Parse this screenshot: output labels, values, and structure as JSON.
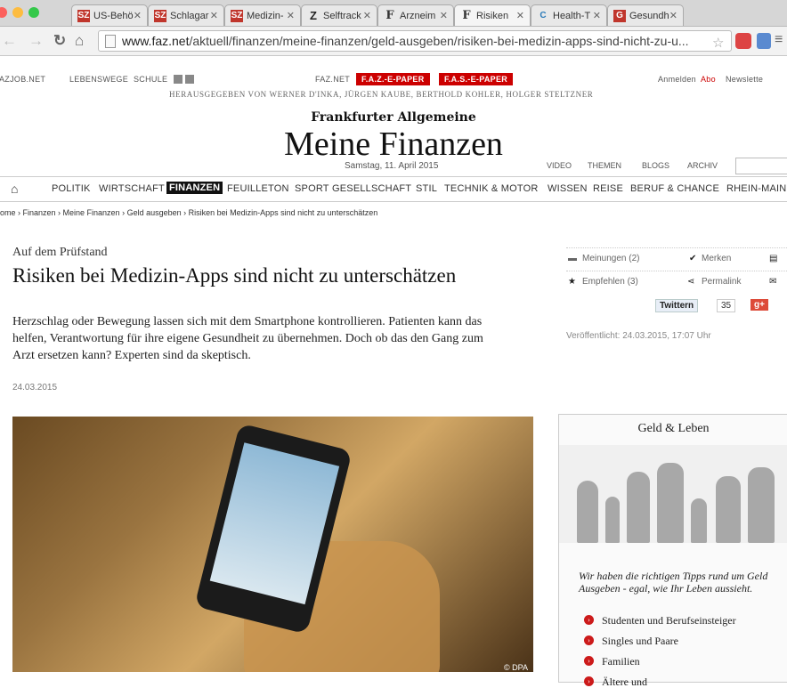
{
  "browser": {
    "tabs": [
      {
        "label": "US-Behö",
        "favicon": "SZ"
      },
      {
        "label": "Schlagar",
        "favicon": "SZ"
      },
      {
        "label": "Medizin-",
        "favicon": "SZ"
      },
      {
        "label": "Selftrack",
        "favicon": "Z"
      },
      {
        "label": "Arzneim",
        "favicon": "F"
      },
      {
        "label": "Risiken",
        "favicon": "F"
      },
      {
        "label": "Health-T",
        "favicon": "C"
      },
      {
        "label": "Gesundh",
        "favicon": "G"
      }
    ],
    "url_host": "www.faz.net",
    "url_path": "/aktuell/finanzen/meine-finanzen/geld-ausgeben/risiken-bei-medizin-apps-sind-nicht-zu-u..."
  },
  "header": {
    "topnav": [
      "AZJOB.NET",
      "LEBENSWEGE",
      "SCHULE"
    ],
    "faznet": "FAZ.NET",
    "epaper1": "F.A.Z.-E-PAPER",
    "epaper2": "F.A.S.-E-PAPER",
    "anmelden": "Anmelden",
    "abo": "Abo",
    "newsletter": "Newslette",
    "herausgeber": "HERAUSGEGEBEN VON WERNER D'INKA, JÜRGEN KAUBE, BERTHOLD KOHLER, HOLGER STELTZNER",
    "masthead": "Frankfurter Allgemeine",
    "section_title": "Meine Finanzen",
    "date": "Samstag, 11. April 2015",
    "subnav": [
      "VIDEO",
      "THEMEN",
      "BLOGS",
      "ARCHIV"
    ]
  },
  "mainnav": [
    "POLITIK",
    "WIRTSCHAFT",
    "FINANZEN",
    "FEUILLETON",
    "SPORT",
    "GESELLSCHAFT",
    "STIL",
    "TECHNIK & MOTOR",
    "WISSEN",
    "REISE",
    "BERUF & CHANCE",
    "RHEIN-MAIN"
  ],
  "breadcrumb": "ome › Finanzen › Meine Finanzen › Geld ausgeben › Risiken bei Medizin-Apps sind nicht zu unterschätzen",
  "article": {
    "kicker": "Auf dem Prüfstand",
    "headline": "Risiken bei Medizin-Apps sind nicht zu unterschätzen",
    "teaser": "Herzschlag oder Bewegung lassen sich mit dem Smartphone kontrollieren. Patienten kann das helfen, Verantwortung für ihre eigene Gesundheit zu übernehmen. Doch ob das den Gang zum Arzt ersetzen kann? Experten sind da skeptisch.",
    "date": "24.03.2015",
    "photo_credit": "© DPA"
  },
  "social": {
    "meinungen": "Meinungen (2)",
    "merken": "Merken",
    "empfehlen": "Empfehlen (3)",
    "permalink": "Permalink",
    "twittern": "Twittern",
    "twitter_count": "35",
    "gplus": "g+",
    "published": "Veröffentlicht: 24.03.2015, 17:07 Uhr"
  },
  "sidebar": {
    "title": "Geld & Leben",
    "text": "Wir haben die richtigen Tipps rund um Geld Ausgeben - egal, wie Ihr Leben aussieht.",
    "items": [
      "Studenten und Berufseinsteiger",
      "Singles und Paare",
      "Familien",
      "Ältere und"
    ]
  }
}
